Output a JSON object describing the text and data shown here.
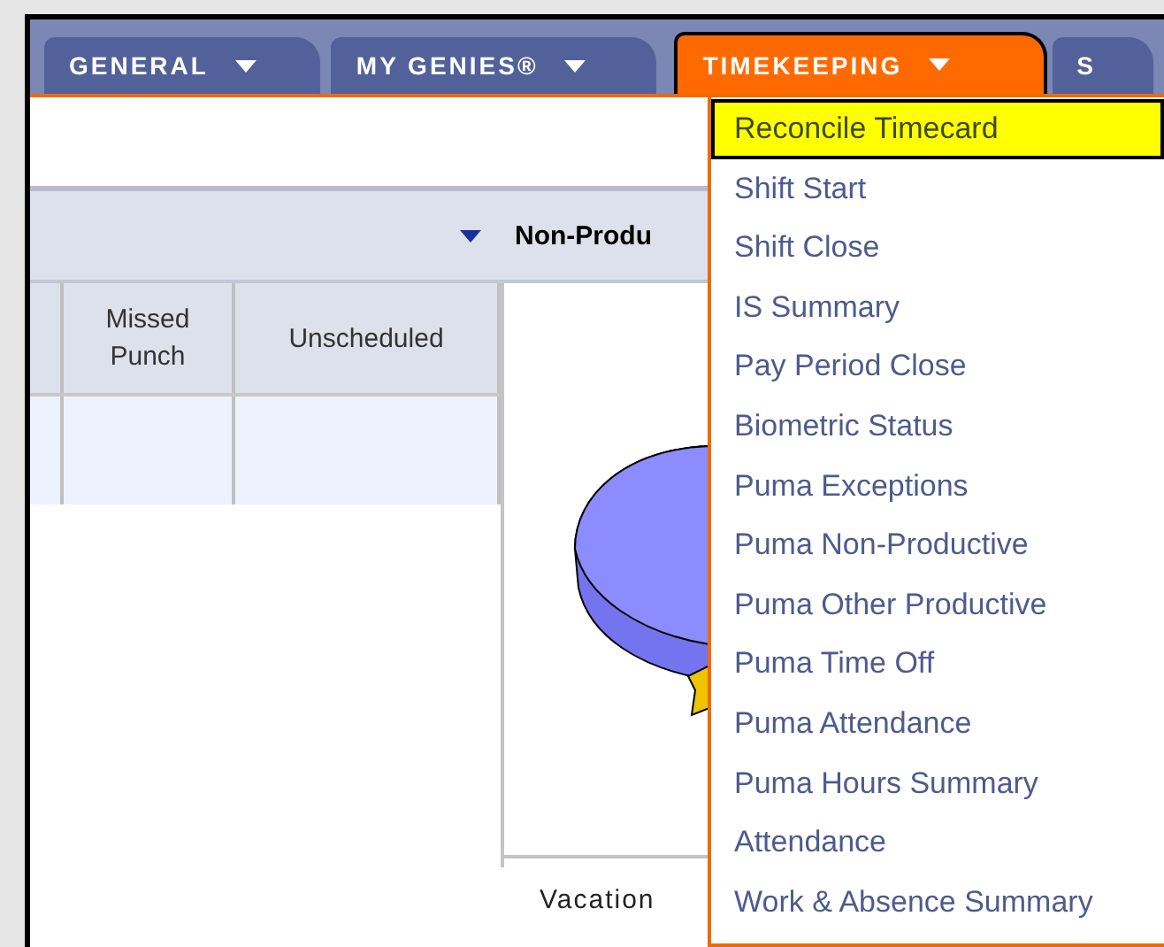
{
  "tabs": [
    {
      "label": "GENERAL",
      "selected": false,
      "caret": true
    },
    {
      "label": "MY GENIES®",
      "selected": false,
      "caret": true
    },
    {
      "label": "TIMEKEEPING",
      "selected": true,
      "caret": true
    },
    {
      "label": "S",
      "selected": false,
      "caret": false
    }
  ],
  "toolbar": {
    "filter_label": "Non-Produ"
  },
  "table": {
    "columns": [
      "Missed Punch",
      "Unscheduled"
    ]
  },
  "chart_panel": {
    "legend_label": "Vacation"
  },
  "menu": {
    "items": [
      {
        "label": "Reconcile Timecard",
        "selected": true
      },
      {
        "label": "Shift Start",
        "selected": false
      },
      {
        "label": "Shift Close",
        "selected": false
      },
      {
        "label": "IS Summary",
        "selected": false
      },
      {
        "label": "Pay Period Close",
        "selected": false
      },
      {
        "label": "Biometric Status",
        "selected": false
      },
      {
        "label": "Puma Exceptions",
        "selected": false
      },
      {
        "label": "Puma Non-Productive",
        "selected": false
      },
      {
        "label": "Puma Other Productive",
        "selected": false
      },
      {
        "label": "Puma Time Off",
        "selected": false
      },
      {
        "label": "Puma Attendance",
        "selected": false
      },
      {
        "label": "Puma Hours Summary",
        "selected": false
      },
      {
        "label": "Attendance",
        "selected": false
      },
      {
        "label": "Work & Absence Summary",
        "selected": false
      }
    ]
  }
}
